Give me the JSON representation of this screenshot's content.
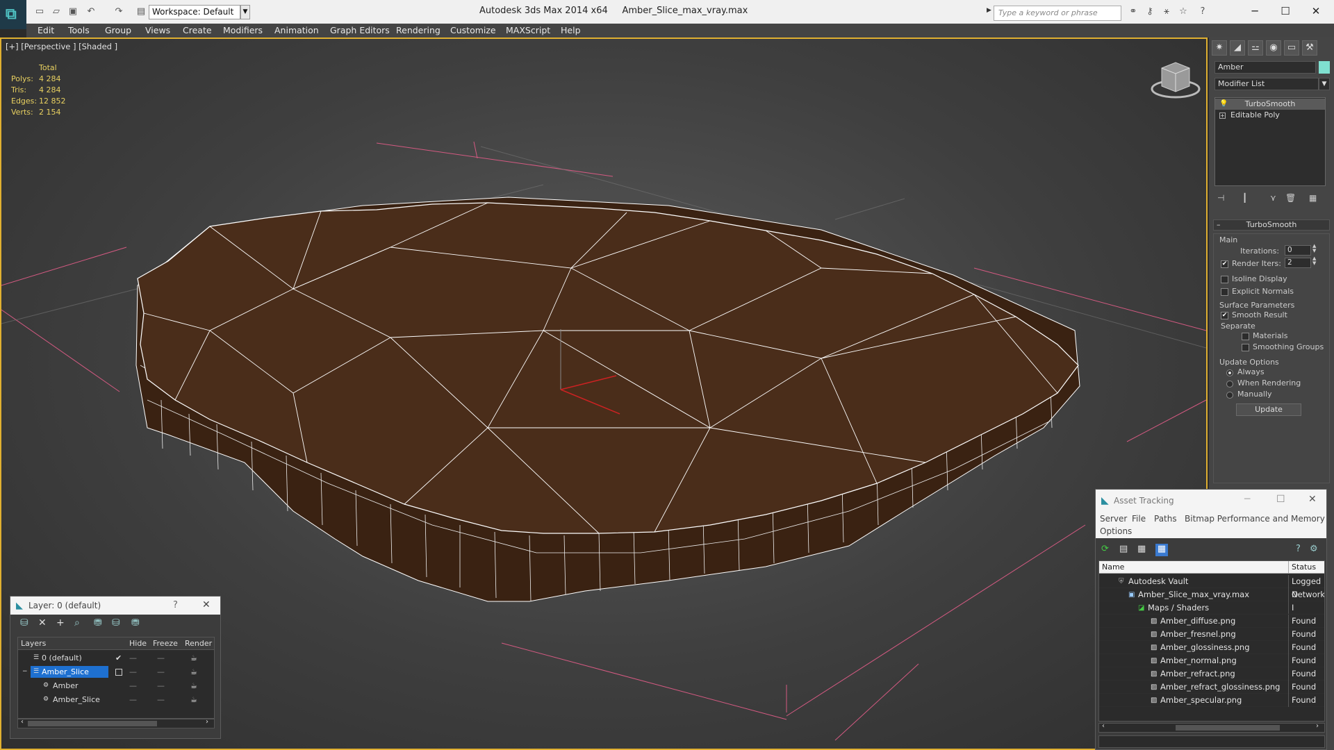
{
  "window": {
    "app_title": "Autodesk 3ds Max  2014 x64",
    "file_name": "Amber_Slice_max_vray.max",
    "workspace": "Workspace: Default",
    "search_placeholder": "Type a keyword or phrase"
  },
  "menu": [
    "Edit",
    "Tools",
    "Group",
    "Views",
    "Create",
    "Modifiers",
    "Animation",
    "Graph Editors",
    "Rendering",
    "Customize",
    "MAXScript",
    "Help"
  ],
  "viewport": {
    "label": "[+] [Perspective ] [Shaded ]",
    "stats": {
      "header": "Total",
      "rows": [
        {
          "label": "Polys:",
          "value": "4 284"
        },
        {
          "label": "Tris:",
          "value": "4 284"
        },
        {
          "label": "Edges:",
          "value": "12 852"
        },
        {
          "label": "Verts:",
          "value": "2 154"
        }
      ]
    },
    "colors": {
      "frame": "#e0b030",
      "model": "#4a2c1a",
      "wire": "#ffffff",
      "grid": "#d05a80"
    }
  },
  "command_panel": {
    "object_name": "Amber",
    "object_color": "#7fe0d0",
    "modifier_list": "Modifier List",
    "stack": [
      "TurboSmooth",
      "Editable Poly"
    ],
    "rollout": {
      "title": "TurboSmooth",
      "main_label": "Main",
      "iterations_label": "Iterations:",
      "iterations_value": "0",
      "render_iters_label": "Render Iters:",
      "render_iters_value": "2",
      "isoline_label": "Isoline Display",
      "explicit_normals_label": "Explicit Normals",
      "surface_params_label": "Surface Parameters",
      "smooth_result_label": "Smooth Result",
      "separate_label": "Separate",
      "materials_label": "Materials",
      "smoothing_groups_label": "Smoothing Groups",
      "update_options_label": "Update Options",
      "always_label": "Always",
      "when_rendering_label": "When Rendering",
      "manually_label": "Manually",
      "update_button": "Update"
    }
  },
  "layer_window": {
    "title": "Layer: 0 (default)",
    "help": "?",
    "columns": [
      "Layers",
      "Hide",
      "Freeze",
      "Render"
    ],
    "rows": [
      "0 (default)",
      "Amber_Slice",
      "Amber",
      "Amber_Slice"
    ]
  },
  "asset_window": {
    "title": "Asset Tracking",
    "menu": [
      "Server",
      "File",
      "Paths",
      "Bitmap Performance and Memory"
    ],
    "menu2": "Options",
    "columns": [
      "Name",
      "Status"
    ],
    "rows": [
      {
        "name": "Autodesk Vault",
        "status": "Logged O"
      },
      {
        "name": "Amber_Slice_max_vray.max",
        "status": "Network I"
      },
      {
        "name": "Maps / Shaders",
        "status": ""
      },
      {
        "name": "Amber_diffuse.png",
        "status": "Found"
      },
      {
        "name": "Amber_fresnel.png",
        "status": "Found"
      },
      {
        "name": "Amber_glossiness.png",
        "status": "Found"
      },
      {
        "name": "Amber_normal.png",
        "status": "Found"
      },
      {
        "name": "Amber_refract.png",
        "status": "Found"
      },
      {
        "name": "Amber_refract_glossiness.png",
        "status": "Found"
      },
      {
        "name": "Amber_specular.png",
        "status": "Found"
      }
    ]
  }
}
